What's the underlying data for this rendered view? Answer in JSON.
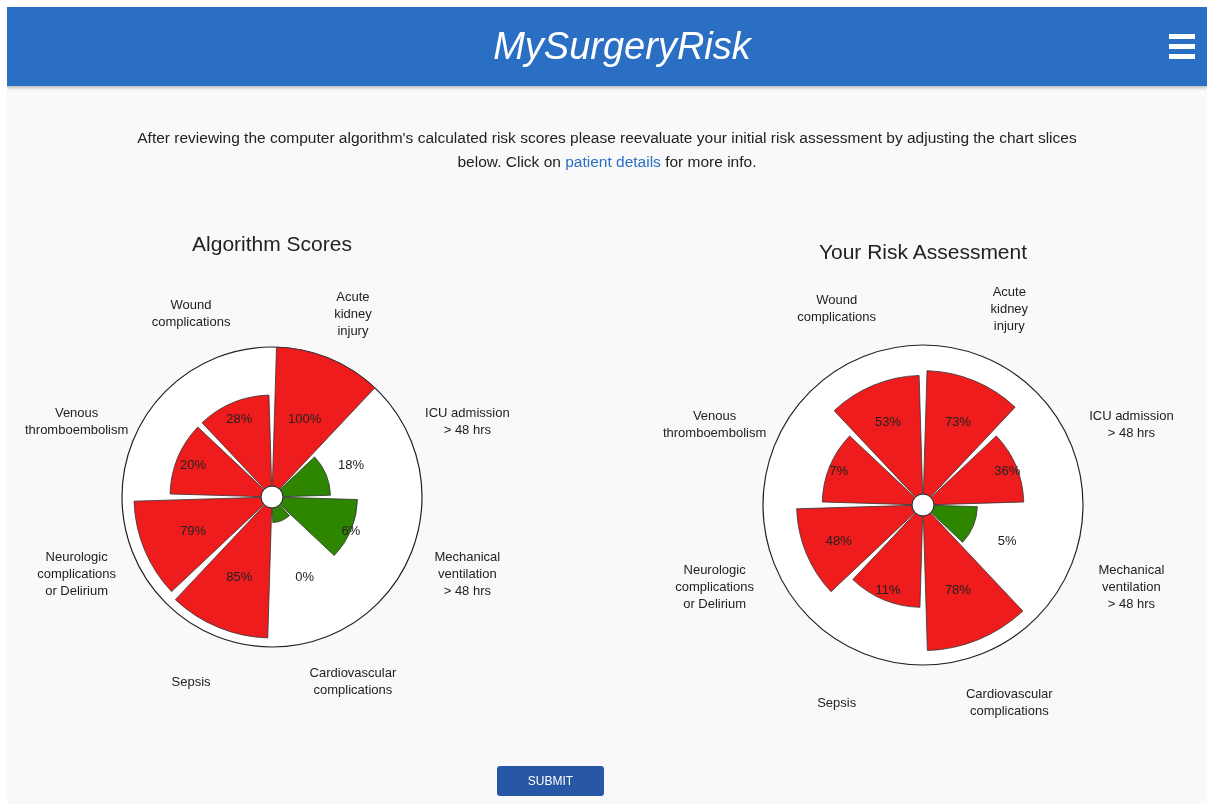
{
  "header": {
    "title": "MySurgeryRisk"
  },
  "intro": {
    "text": "After reviewing the computer algorithm's calculated risk scores please reevaluate your initial risk assessment by adjusting the chart slices below. Click on ",
    "link": "patient details",
    "text_after": " for more info."
  },
  "charts": [
    {
      "title": "Algorithm Scores",
      "slices": [
        {
          "label": "Venous\nthromboembolism",
          "reading": "20%",
          "color": "#ee1c1c"
        },
        {
          "label": "Wound\ncomplications",
          "reading": "28%",
          "color": "#ee1c1c"
        },
        {
          "label": "Acute\nkidney\ninjury",
          "reading": "100%",
          "color": "#ee1c1c"
        },
        {
          "label": "ICU admission\n> 48 hrs",
          "reading": "18%",
          "color": "#2e8500"
        },
        {
          "label": "Neurologic\ncomplications\nor Delirium",
          "reading": "79%",
          "color": "#ee1c1c"
        },
        {
          "label": "Sepsis",
          "reading": "85%",
          "color": "#ee1c1c"
        },
        {
          "label": "Cardiovascular\ncomplications",
          "reading": "0%",
          "color": "#2e8500"
        },
        {
          "label": "Mechanical\nventilation\n> 48 hrs",
          "reading": "6%",
          "color": "#2e8500"
        }
      ]
    },
    {
      "title": "Your Risk Assessment",
      "slices": [
        {
          "label": "Venous\nthromboembolism",
          "reading": "7%",
          "color": "#ee1c1c"
        },
        {
          "label": "Wound\ncomplications",
          "reading": "53%",
          "color": "#ee1c1c"
        },
        {
          "label": "Acute\nkidney\ninjury",
          "reading": "73%",
          "color": "#ee1c1c"
        },
        {
          "label": "ICU admission\n> 48 hrs",
          "reading": "36%",
          "color": "#ee1c1c"
        },
        {
          "label": "Neurologic\ncomplications\nor Delirium",
          "reading": "48%",
          "color": "#ee1c1c"
        },
        {
          "label": "Sepsis",
          "reading": "11%",
          "color": "#ee1c1c"
        },
        {
          "label": "Cardiovascular\ncomplications",
          "reading": "78%",
          "color": "#ee1c1c"
        },
        {
          "label": "Mechanical\nventilation\n> 48 hrs",
          "reading": "5%",
          "color": "#2e8500"
        }
      ]
    }
  ],
  "buttons": [
    {
      "label": "SUBMIT"
    }
  ]
}
